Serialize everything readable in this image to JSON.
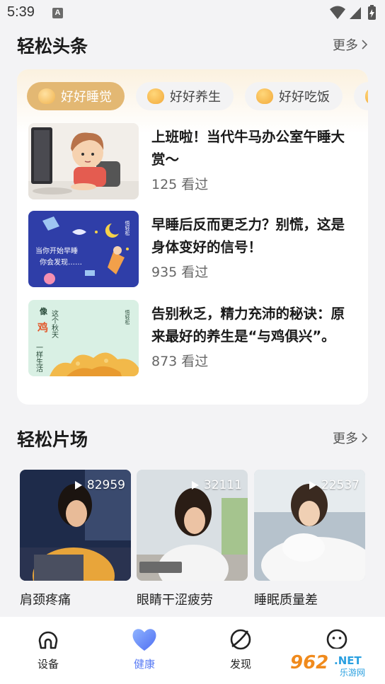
{
  "status": {
    "time": "5:39",
    "notif_letter": "A"
  },
  "headlines": {
    "title": "轻松头条",
    "more": "更多",
    "chips": [
      {
        "label": "好好睡觉",
        "active": true
      },
      {
        "label": "好好养生",
        "active": false
      },
      {
        "label": "好好吃饭",
        "active": false
      }
    ],
    "items": [
      {
        "title": "上班啦！当代牛马办公室午睡大赏～",
        "views": "125 看过"
      },
      {
        "title": "早睡后反而更乏力？别慌，这是身体变好的信号！",
        "views": "935 看过",
        "thumb_text": "当你开始早睡 你会发现……",
        "thumb_tag": "悟轻松"
      },
      {
        "title": "告别秋乏，精力充沛的秘诀：原来最好的养生是“与鸡俱兴”。",
        "views": "873 看过",
        "thumb_lines": [
          "这个秋天",
          "像",
          "鸡",
          "一样生活"
        ],
        "thumb_tag": "悟轻松"
      }
    ]
  },
  "videos": {
    "title": "轻松片场",
    "more": "更多",
    "items": [
      {
        "label": "肩颈疼痛",
        "plays": "82959"
      },
      {
        "label": "眼睛干涩疲劳",
        "plays": "32111"
      },
      {
        "label": "睡眠质量差",
        "plays": "22537"
      }
    ]
  },
  "tabbar": {
    "items": [
      {
        "label": "设备",
        "active": false
      },
      {
        "label": "健康",
        "active": true
      },
      {
        "label": "发现",
        "active": false
      },
      {
        "label": "",
        "active": false
      }
    ]
  },
  "watermark": {
    "brand": "962",
    "suffix": ".NET",
    "site": "乐游网"
  },
  "colors": {
    "accent": "#5a7cf5",
    "chip_active": "#e3b873"
  }
}
